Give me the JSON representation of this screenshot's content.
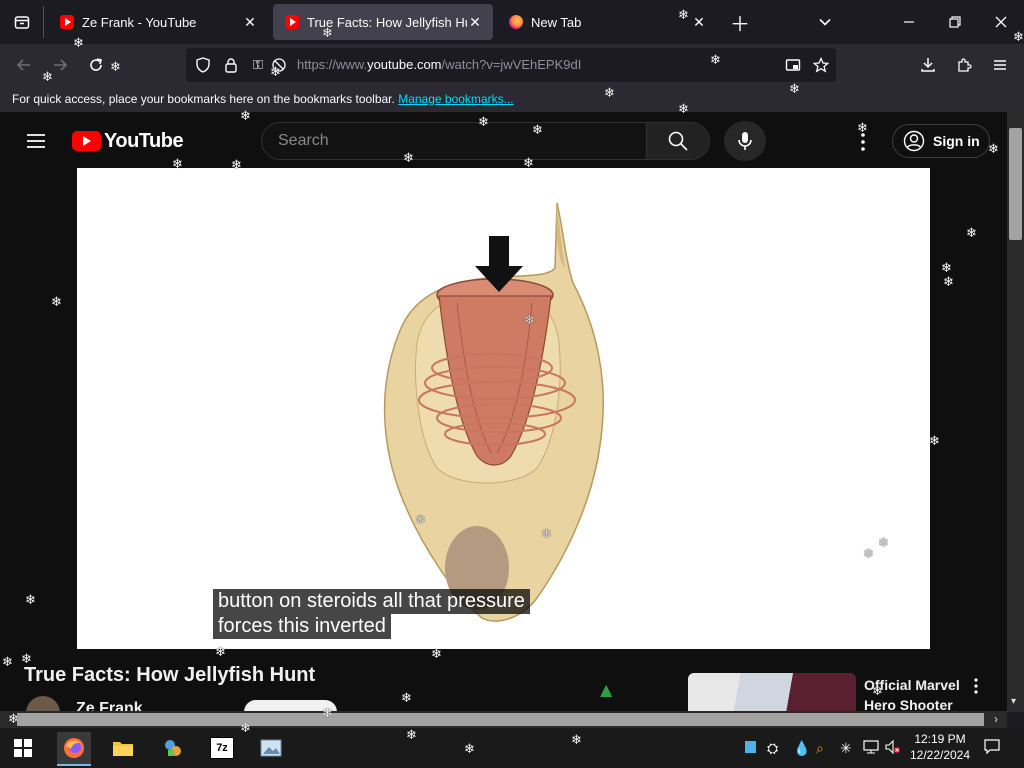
{
  "browser": {
    "tabs": [
      {
        "title": "Ze Frank - YouTube",
        "active": false
      },
      {
        "title": "True Facts: How Jellyfish Hunt",
        "active": true
      },
      {
        "title": "New Tab",
        "active": false
      }
    ],
    "url_prefix": "https://www.",
    "url_domain": "youtube.com",
    "url_path": "/watch?v=jwVEhEPK9dI",
    "bookmarks_text": "For quick access, place your bookmarks here on the bookmarks toolbar.",
    "bookmarks_link": "Manage bookmarks..."
  },
  "youtube": {
    "logo_text": "YouTube",
    "search_placeholder": "Search",
    "sign_in": "Sign in",
    "caption_lines": [
      "button on steroids all that pressure",
      "forces this inverted"
    ],
    "video_title": "True Facts: How Jellyfish Hunt",
    "channel": "Ze Frank",
    "recommended_title_1": "Official Marvel",
    "recommended_title_2": "Hero Shooter"
  },
  "taskbar": {
    "time": "12:19 PM",
    "date": "12/22/2024",
    "icons": [
      "windows-start-icon",
      "firefox-icon",
      "file-explorer-icon",
      "app-icon",
      "7zip-icon",
      "image-viewer-icon"
    ]
  },
  "colors": {
    "browser_bg": "#1c1b22",
    "toolbar_bg": "#2b2a33",
    "active_tab": "#42414d",
    "youtube_red": "#ff0000",
    "youtube_bg": "#0f0f0f",
    "link": "#00ddff"
  }
}
